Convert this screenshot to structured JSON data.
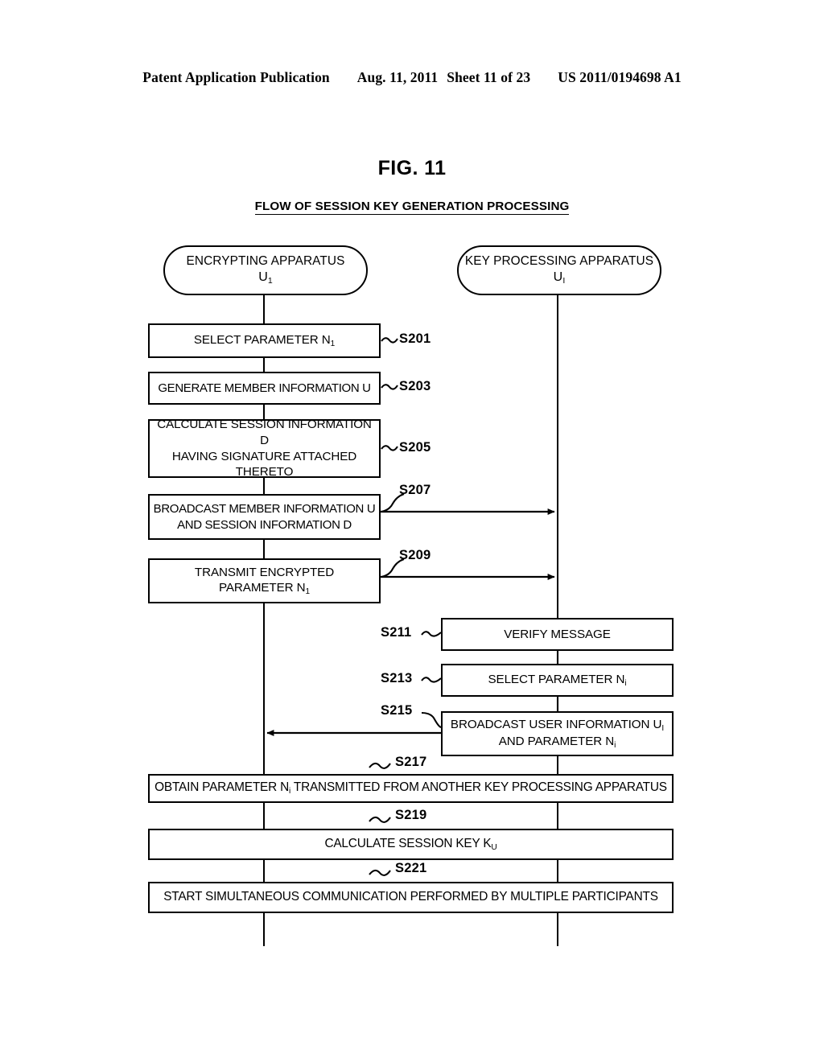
{
  "header": {
    "publication": "Patent Application Publication",
    "date": "Aug. 11, 2011",
    "sheet": "Sheet 11 of 23",
    "number": "US 2011/0194698 A1"
  },
  "figure": {
    "label": "FIG. 11",
    "caption": "FLOW OF SESSION KEY GENERATION PROCESSING"
  },
  "lanes": [
    {
      "id": "encrypting-apparatus",
      "line1": "ENCRYPTING APPARATUS",
      "line2_base": "U",
      "line2_sub": "1"
    },
    {
      "id": "key-processing-apparatus",
      "line1": "KEY PROCESSING APPARATUS",
      "line2_base": "U",
      "line2_sub": "I"
    }
  ],
  "steps": [
    {
      "id": "S201",
      "label": "S201",
      "lane": "left",
      "text": "SELECT PARAMETER N<sub>1</sub>"
    },
    {
      "id": "S203",
      "label": "S203",
      "lane": "left",
      "text": "GENERATE MEMBER INFORMATION U"
    },
    {
      "id": "S205",
      "label": "S205",
      "lane": "left",
      "text": "CALCULATE SESSION INFORMATION D<br>HAVING SIGNATURE ATTACHED<br>THERETO"
    },
    {
      "id": "S207",
      "label": "S207",
      "lane": "left",
      "text": "BROADCAST MEMBER INFORMATION U<br>AND SESSION INFORMATION D"
    },
    {
      "id": "S209",
      "label": "S209",
      "lane": "left",
      "text": "TRANSMIT ENCRYPTED<br>PARAMETER N<sub>1</sub>"
    },
    {
      "id": "S211",
      "label": "S211",
      "lane": "right",
      "text": "VERIFY MESSAGE"
    },
    {
      "id": "S213",
      "label": "S213",
      "lane": "right",
      "text": "SELECT PARAMETER N<sub>i</sub>"
    },
    {
      "id": "S215",
      "label": "S215",
      "lane": "right",
      "text": "BROADCAST USER INFORMATION U<sub>I</sub><br>AND PARAMETER N<sub>i</sub>"
    },
    {
      "id": "S217",
      "label": "S217",
      "lane": "both",
      "text": "OBTAIN PARAMETER N<sub>i</sub> TRANSMITTED FROM ANOTHER KEY PROCESSING APPARATUS"
    },
    {
      "id": "S219",
      "label": "S219",
      "lane": "both",
      "text": "CALCULATE SESSION KEY K<sub>U</sub>"
    },
    {
      "id": "S221",
      "label": "S221",
      "lane": "both",
      "text": "START SIMULTANEOUS COMMUNICATION PERFORMED BY MULTIPLE PARTICIPANTS"
    }
  ],
  "flows": [
    {
      "id": "flow-s207",
      "from": "left",
      "to": "right",
      "direction": "right"
    },
    {
      "id": "flow-s209",
      "from": "left",
      "to": "right",
      "direction": "right"
    },
    {
      "id": "flow-s215",
      "from": "right",
      "to": "left",
      "direction": "left"
    }
  ],
  "colors": {
    "ink": "#000000",
    "paper": "#ffffff"
  }
}
